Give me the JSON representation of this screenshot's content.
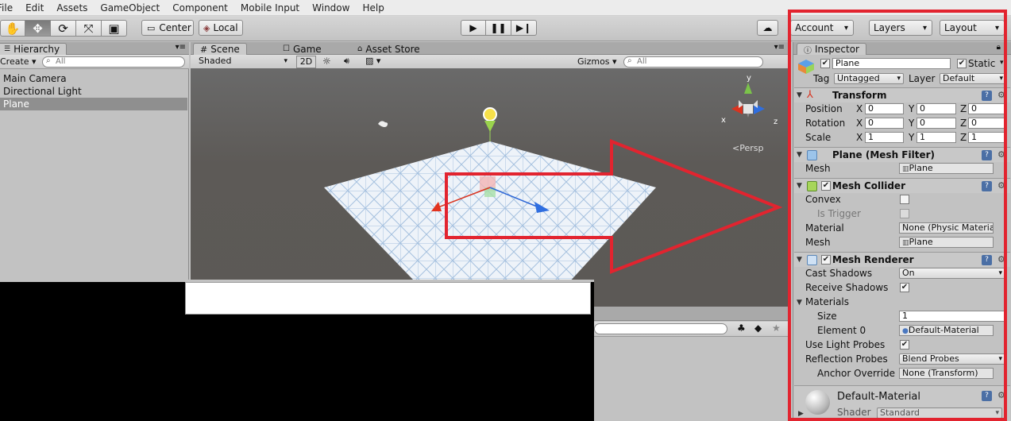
{
  "menu": [
    "File",
    "Edit",
    "Assets",
    "GameObject",
    "Component",
    "Mobile Input",
    "Window",
    "Help"
  ],
  "toolbar": {
    "tools": [
      "hand-icon",
      "move-icon",
      "rotate-icon",
      "scale-icon",
      "rect-icon"
    ],
    "pivot_label": "Center",
    "space_label": "Local",
    "account_label": "Account",
    "layers_label": "Layers",
    "layout_label": "Layout"
  },
  "hierarchy": {
    "tab_label": "Hierarchy",
    "create_label": "Create",
    "search_placeholder": "All",
    "items": [
      "Main Camera",
      "Directional Light",
      "Plane"
    ],
    "selected": "Plane"
  },
  "scene": {
    "tabs": [
      "Scene",
      "Game",
      "Asset Store"
    ],
    "shading_label": "Shaded",
    "mode_2d_label": "2D",
    "gizmos_label": "Gizmos",
    "search_placeholder": "All",
    "persp_label": "Persp",
    "axis_labels": {
      "x": "x",
      "y": "y",
      "z": "z"
    }
  },
  "inspector": {
    "tab_label": "Inspector",
    "object_name": "Plane",
    "static_label": "Static",
    "tag_label": "Tag",
    "tag_value": "Untagged",
    "layer_label": "Layer",
    "layer_value": "Default",
    "transform": {
      "title": "Transform",
      "rows": [
        {
          "label": "Position",
          "x": "0",
          "y": "0",
          "z": "0"
        },
        {
          "label": "Rotation",
          "x": "0",
          "y": "0",
          "z": "0"
        },
        {
          "label": "Scale",
          "x": "1",
          "y": "1",
          "z": "1"
        }
      ]
    },
    "mesh_filter": {
      "title": "Plane (Mesh Filter)",
      "mesh_label": "Mesh",
      "mesh_value": "Plane"
    },
    "mesh_collider": {
      "title": "Mesh Collider",
      "convex_label": "Convex",
      "is_trigger_label": "Is Trigger",
      "material_label": "Material",
      "material_value": "None (Physic Materia",
      "mesh_label": "Mesh",
      "mesh_value": "Plane"
    },
    "mesh_renderer": {
      "title": "Mesh Renderer",
      "cast_shadows_label": "Cast Shadows",
      "cast_shadows_value": "On",
      "receive_shadows_label": "Receive Shadows",
      "materials_label": "Materials",
      "size_label": "Size",
      "size_value": "1",
      "element0_label": "Element 0",
      "element0_value": "Default-Material",
      "light_probes_label": "Use Light Probes",
      "reflection_probes_label": "Reflection Probes",
      "reflection_probes_value": "Blend Probes",
      "anchor_override_label": "Anchor Override",
      "anchor_override_value": "None (Transform)"
    },
    "material": {
      "name": "Default-Material",
      "shader_label": "Shader",
      "shader_value": "Standard"
    }
  },
  "colors": {
    "highlight": "#e2242f",
    "panel": "#c2c2c2",
    "selection": "#8f8f8f"
  }
}
